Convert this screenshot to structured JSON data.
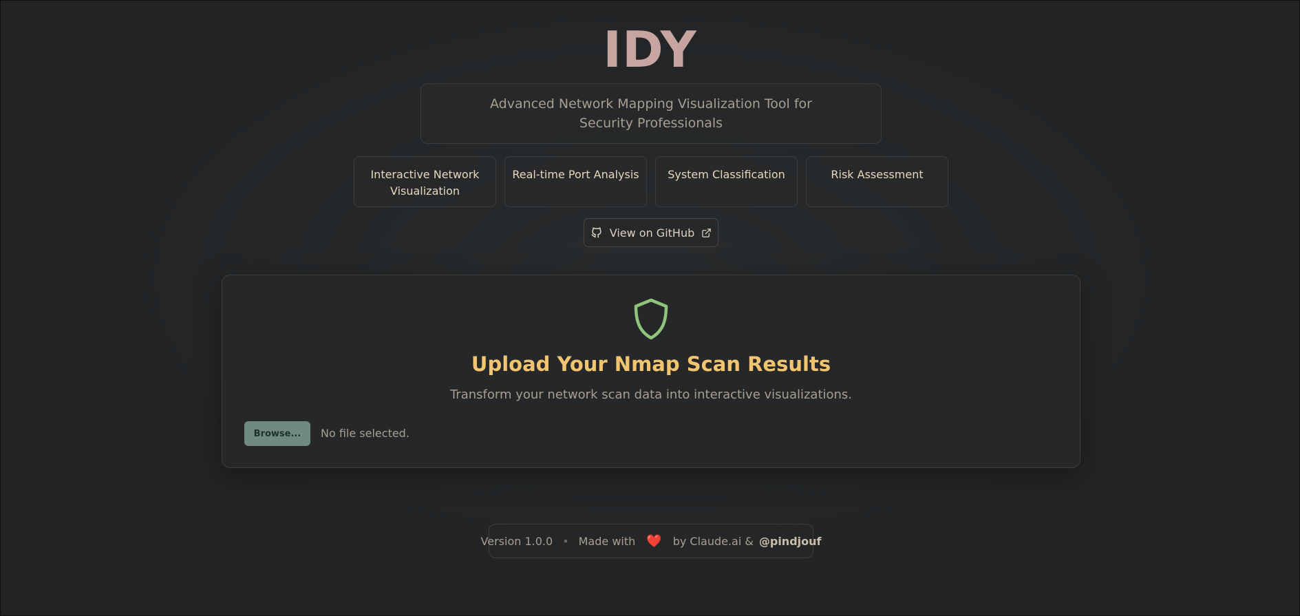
{
  "app": {
    "title": "IDY",
    "subtitle": "Advanced Network Mapping Visualization Tool for Security Professionals"
  },
  "features": [
    {
      "label": "Interactive Network Visualization"
    },
    {
      "label": "Real-time Port Analysis"
    },
    {
      "label": "System Classification"
    },
    {
      "label": "Risk Assessment"
    }
  ],
  "github": {
    "label": "View on GitHub",
    "icon": "github-icon",
    "external_icon": "external-link-icon"
  },
  "upload": {
    "icon": "shield-icon",
    "title": "Upload Your Nmap Scan Results",
    "description": "Transform your network scan data into interactive visualizations.",
    "browse_label": "Browse...",
    "file_status": "No file selected."
  },
  "footer": {
    "version": "Version 1.0.0",
    "separator": "•",
    "made_with": "Made with",
    "heart": "❤️",
    "by": "by Claude.ai &",
    "handle": "@pindjouf"
  },
  "colors": {
    "background": "#222426",
    "accent_title": "#f0c470",
    "shield": "#8fc47a",
    "browse_button": "#6f8b7f",
    "heart": "#d03a3a"
  }
}
